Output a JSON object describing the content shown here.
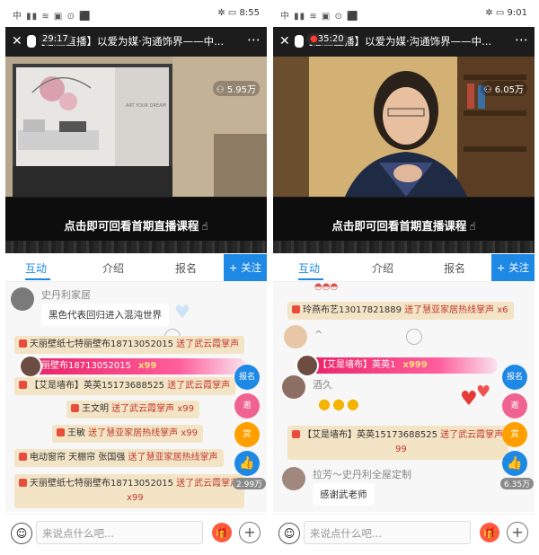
{
  "colors": {
    "accent": "#1e88e5",
    "gift_bg": "#f4e4c6",
    "gift_text": "#c0392b",
    "banner": "#e91e63",
    "gift_button": "#ff5a3c"
  },
  "phones": [
    {
      "status": {
        "left_icons": "中 ▮▮ ≋ ▣ ⊙ ⬛",
        "right_icons": "✲ ▭",
        "time": "8:55"
      },
      "timer": "29:17",
      "title": "【慧亚直播】以爱为媒·沟通饰界——中...",
      "viewers": "5.95万",
      "replay": "点击即可回看首期直播课程",
      "tabs": [
        "互动",
        "介绍",
        "报名"
      ],
      "follow": "+ 关注",
      "chat": {
        "user1": "史丹利家居",
        "msg1": "黑色代表回归进入混沌世界",
        "gift1": {
          "who": "天丽壁纸七特丽壁布18713052015",
          "text": " 送了武云霞掌声"
        },
        "banner": {
          "text": "丽壁布18713052015",
          "count": "x99"
        },
        "gift2": {
          "who": "【艾是墙布】英英15173688525",
          "text": " 送了武云霞掌声"
        },
        "gift3": {
          "who": "王文明",
          "text": " 送了武云霞掌声 x99"
        },
        "gift4": {
          "who": "王敏",
          "text": " 送了慧亚家居热线掌声 x99"
        },
        "gift5": {
          "who": "电动窗帘 天棚帘 张国强",
          "text": " 送了慧亚家居热线掌声"
        },
        "gift6": {
          "who": "天丽壁纸七特丽壁布18713052015",
          "text": " 送了武云霞掌声",
          "count": "x99"
        },
        "side_buttons": [
          "报名",
          "邀",
          "赏"
        ],
        "count_badge": "2.99万"
      },
      "input_placeholder": "来说点什么吧..."
    },
    {
      "status": {
        "left_icons": "中 ▮▮ ≋ ▣ ⊙ ⬛",
        "right_icons": "✲ ▭",
        "time": "9:01"
      },
      "timer": "35:20",
      "title": "【慧亚直播】以爱为媒·沟通饰界——中...",
      "viewers": "6.05万",
      "replay": "点击即可回看首期直播课程",
      "tabs": [
        "互动",
        "介绍",
        "报名"
      ],
      "follow": "+ 关注",
      "chat": {
        "gift1": {
          "who": "玲燕布艺13017821889",
          "text": " 送了慧亚家居热线掌声 x6"
        },
        "short_msg": "^",
        "banner": {
          "text": "【艾是墙布】英英1",
          "count": "x999"
        },
        "user2": "酒久",
        "gift2": {
          "who": "【艾是墙布】英英15173688525",
          "text": " 送了武云霞掌声",
          "count": "99"
        },
        "user3": "拉芳～史丹利全屋定制",
        "msg3": "感谢武老师",
        "side_buttons": [
          "报名",
          "邀",
          "赏"
        ],
        "count_badge": "6.35万"
      },
      "input_placeholder": "来说点什么吧..."
    }
  ]
}
